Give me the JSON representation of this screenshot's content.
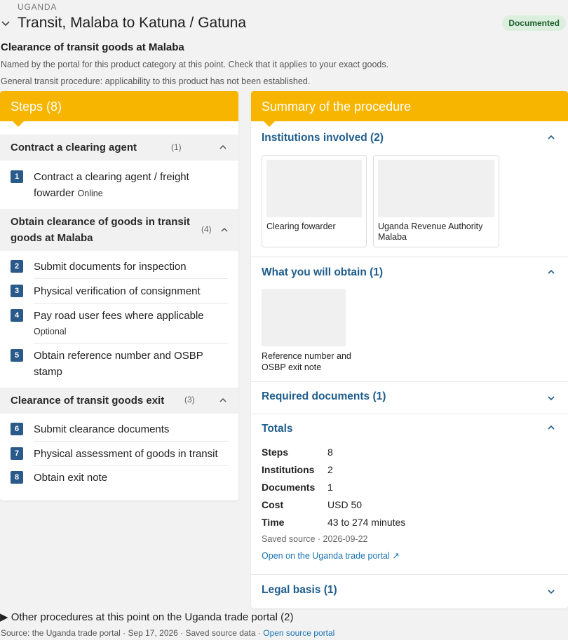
{
  "country": "UGANDA",
  "title": "Transit, Malaba to Katuna / Gatuna",
  "status_badge": "Documented",
  "subheading": "Clearance of transit goods at Malaba",
  "note_named": "Named by the portal for this product category at this point. Check that it applies to your exact goods.",
  "note_general": "General transit procedure: applicability to this product has not been established.",
  "steps_panel": {
    "title": "Steps (8)",
    "groups": [
      {
        "title": "Contract a clearing agent",
        "count": "(1)",
        "steps": [
          {
            "num": "1",
            "label": "Contract a clearing agent / freight fowarder",
            "tag": "Online"
          }
        ]
      },
      {
        "title": "Obtain clearance of goods in transit goods at Malaba",
        "count": "(4)",
        "steps": [
          {
            "num": "2",
            "label": "Submit documents for inspection"
          },
          {
            "num": "3",
            "label": "Physical verification of consignment"
          },
          {
            "num": "4",
            "label": "Pay road user fees where applicable",
            "sub": "Optional"
          },
          {
            "num": "5",
            "label": "Obtain reference number and OSBP stamp"
          }
        ]
      },
      {
        "title": "Clearance of transit goods exit",
        "count": "(3)",
        "steps": [
          {
            "num": "6",
            "label": "Submit clearance documents"
          },
          {
            "num": "7",
            "label": "Physical assessment of goods in transit"
          },
          {
            "num": "8",
            "label": "Obtain exit note"
          }
        ]
      }
    ]
  },
  "summary": {
    "title": "Summary of the procedure",
    "institutions_title": "Institutions involved (2)",
    "institutions": [
      {
        "name": "Clearing fowarder"
      },
      {
        "name": "Uganda Revenue Authority Malaba"
      }
    ],
    "obtain_title": "What you will obtain (1)",
    "obtain_items": [
      {
        "name": "Reference number and OSBP exit note"
      }
    ],
    "required_docs_title": "Required documents (1)",
    "totals_title": "Totals",
    "totals": [
      {
        "label": "Steps",
        "value": "8"
      },
      {
        "label": "Institutions",
        "value": "2"
      },
      {
        "label": "Documents",
        "value": "1"
      },
      {
        "label": "Cost",
        "value": "USD 50"
      },
      {
        "label": "Time",
        "value": "43 to 274 minutes"
      }
    ],
    "saved_source": "Saved source · 2026-09-22",
    "portal_link": "Open on the Uganda trade portal ↗",
    "legal_basis_title": "Legal basis (1)"
  },
  "other_procedures": "Other procedures at this point on the Uganda trade portal (2)",
  "footer": {
    "text": "Source: the Uganda trade portal · Sep 17, 2026 · Saved source data · ",
    "link": "Open source portal"
  },
  "colors": {
    "accent": "#f7b500",
    "link": "#1f5d8c",
    "step_badge": "#2a5a8a",
    "status_bg": "#dcefdf"
  }
}
